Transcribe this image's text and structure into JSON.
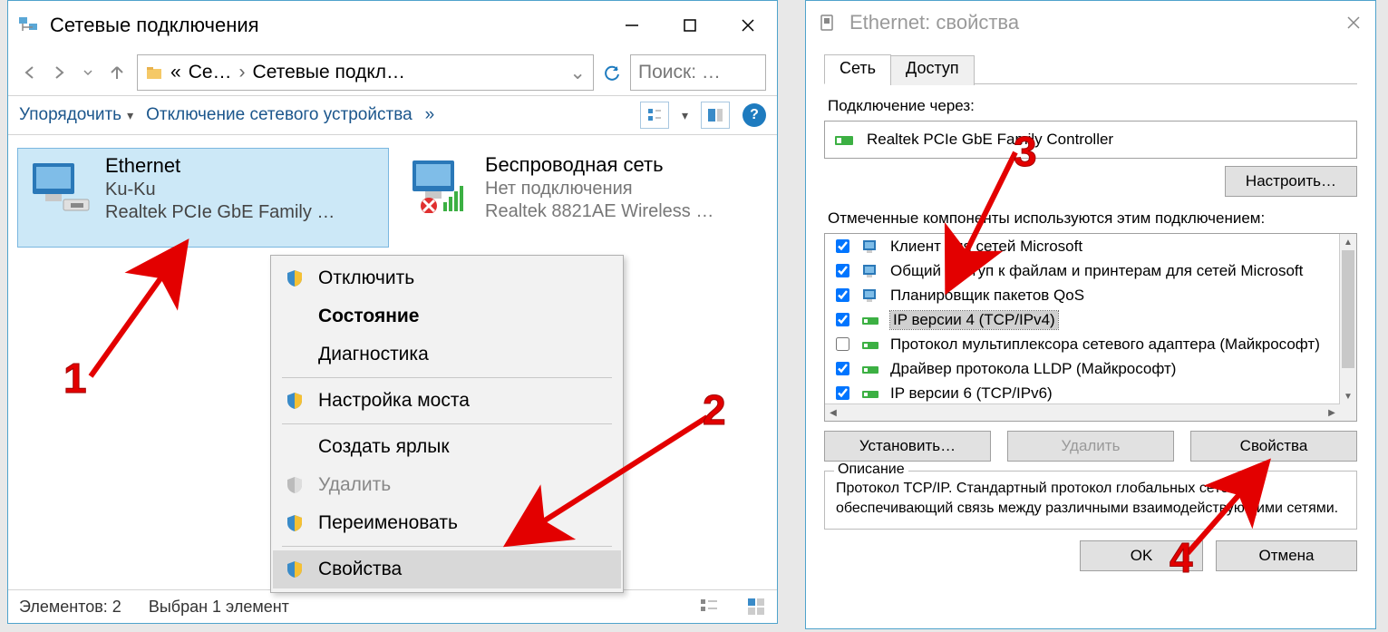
{
  "left": {
    "title": "Сетевые подключения",
    "breadcrumb": {
      "part1": "Се…",
      "part2": "Сетевые подкл…"
    },
    "search_placeholder": "Поиск: …",
    "toolbar": {
      "organize": "Упорядочить",
      "disable": "Отключение сетевого устройства"
    },
    "connections": [
      {
        "name": "Ethernet",
        "status": "Ku-Ku",
        "device": "Realtek PCIe GbE Family …",
        "selected": true
      },
      {
        "name": "Беспроводная сеть",
        "status": "Нет подключения",
        "device": "Realtek 8821AE Wireless …",
        "selected": false
      }
    ],
    "statusbar": {
      "items": "Элементов: 2",
      "selected": "Выбран 1 элемент"
    },
    "context_menu": [
      {
        "label": "Отключить",
        "shield": true,
        "bold": false,
        "disabled": false
      },
      {
        "label": "Состояние",
        "shield": false,
        "bold": true,
        "disabled": false
      },
      {
        "label": "Диагностика",
        "shield": false,
        "bold": false,
        "disabled": false
      },
      {
        "divider": true
      },
      {
        "label": "Настройка моста",
        "shield": true,
        "bold": false,
        "disabled": false
      },
      {
        "divider": true
      },
      {
        "label": "Создать ярлык",
        "shield": false,
        "bold": false,
        "disabled": false
      },
      {
        "label": "Удалить",
        "shield": true,
        "bold": false,
        "disabled": true
      },
      {
        "label": "Переименовать",
        "shield": true,
        "bold": false,
        "disabled": false
      },
      {
        "divider": true
      },
      {
        "label": "Свойства",
        "shield": true,
        "bold": false,
        "disabled": false,
        "highlight": true
      }
    ]
  },
  "right": {
    "title": "Ethernet: свойства",
    "tabs": {
      "network": "Сеть",
      "access": "Доступ"
    },
    "connect_through_label": "Подключение через:",
    "adapter": "Realtek PCIe GbE Family Controller",
    "configure_btn": "Настроить…",
    "components_label": "Отмеченные компоненты используются этим подключением:",
    "components": [
      {
        "checked": true,
        "label": "Клиент для сетей Microsoft"
      },
      {
        "checked": true,
        "label": "Общий доступ к файлам и принтерам для сетей Microsoft"
      },
      {
        "checked": true,
        "label": "Планировщик пакетов QoS"
      },
      {
        "checked": true,
        "label": "IP версии 4 (TCP/IPv4)",
        "selected": true
      },
      {
        "checked": false,
        "label": "Протокол мультиплексора сетевого адаптера (Майкрософт)"
      },
      {
        "checked": true,
        "label": "Драйвер протокола LLDP (Майкрософт)"
      },
      {
        "checked": true,
        "label": "IP версии 6 (TCP/IPv6)"
      }
    ],
    "install_btn": "Установить…",
    "remove_btn": "Удалить",
    "props_btn": "Свойства",
    "description": {
      "caption": "Описание",
      "text": "Протокол TCP/IP. Стандартный протокол глобальных сетей, обеспечивающий связь между различными взаимодействующими сетями."
    },
    "ok_btn": "OK",
    "cancel_btn": "Отмена"
  },
  "annotations": {
    "n1": "1",
    "n2": "2",
    "n3": "3",
    "n4": "4"
  }
}
